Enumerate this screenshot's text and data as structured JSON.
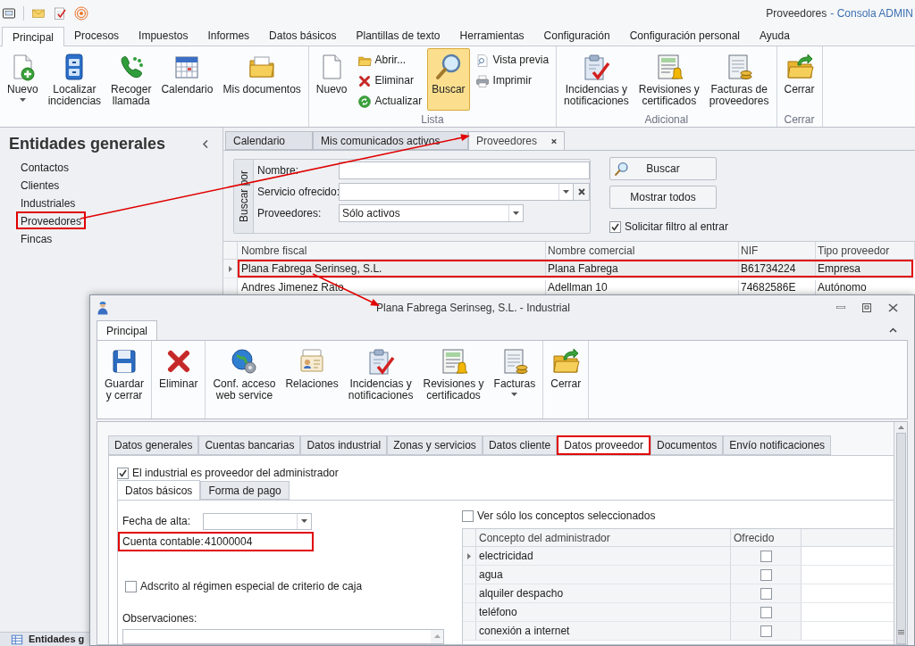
{
  "window": {
    "title": "Proveedores",
    "app_name": "- Consola ADMIN"
  },
  "menu_tabs": [
    {
      "label": "Principal",
      "selected": true
    },
    {
      "label": "Procesos",
      "selected": false
    },
    {
      "label": "Impuestos",
      "selected": false
    },
    {
      "label": "Informes",
      "selected": false
    },
    {
      "label": "Datos básicos",
      "selected": false
    },
    {
      "label": "Plantillas de texto",
      "selected": false
    },
    {
      "label": "Herramientas",
      "selected": false
    },
    {
      "label": "Configuración",
      "selected": false
    },
    {
      "label": "Configuración personal",
      "selected": false
    },
    {
      "label": "Ayuda",
      "selected": false
    }
  ],
  "ribbon": {
    "groups": [
      {
        "items": [
          {
            "label": "Nuevo",
            "kind": "large",
            "dropdown": true,
            "pressed": false
          },
          {
            "label": "Localizar\nincidencias",
            "kind": "large",
            "dropdown": false,
            "pressed": false
          },
          {
            "label": "Recoger\nllamada",
            "kind": "large",
            "dropdown": false,
            "pressed": false
          },
          {
            "label": "Calendario",
            "kind": "large",
            "dropdown": false,
            "pressed": false
          },
          {
            "label": "Mis documentos",
            "kind": "large",
            "dropdown": false,
            "pressed": false
          }
        ]
      },
      {
        "label": "Lista",
        "items": [
          {
            "label": "Nuevo",
            "kind": "large",
            "dropdown": false,
            "pressed": false
          },
          {
            "label": "Abrir...",
            "kind": "small",
            "dropdown": false,
            "pressed": false
          },
          {
            "label": "Eliminar",
            "kind": "small",
            "dropdown": false,
            "pressed": false
          },
          {
            "label": "Actualizar",
            "kind": "small",
            "dropdown": false,
            "pressed": false
          },
          {
            "label": "Buscar",
            "kind": "large",
            "dropdown": false,
            "pressed": true
          },
          {
            "label": "Vista previa",
            "kind": "small",
            "dropdown": false,
            "pressed": false
          },
          {
            "label": "Imprimir",
            "kind": "small",
            "dropdown": false,
            "pressed": false
          }
        ]
      },
      {
        "label": "Adicional",
        "items": [
          {
            "label": "Incidencias y\nnotificaciones",
            "kind": "large",
            "dropdown": false,
            "pressed": false
          },
          {
            "label": "Revisiones y\ncertificados",
            "kind": "large",
            "dropdown": false,
            "pressed": false
          },
          {
            "label": "Facturas de\nproveedores",
            "kind": "large",
            "dropdown": false,
            "pressed": false
          }
        ]
      },
      {
        "label": "Cerrar",
        "items": [
          {
            "label": "Cerrar",
            "kind": "large",
            "dropdown": false,
            "pressed": false
          }
        ]
      }
    ]
  },
  "sidebar": {
    "title": "Entidades generales",
    "items": [
      {
        "label": "Contactos",
        "highlighted": false
      },
      {
        "label": "Clientes",
        "highlighted": false
      },
      {
        "label": "Industriales",
        "highlighted": false
      },
      {
        "label": "Proveedores",
        "highlighted": true
      },
      {
        "label": "Fincas",
        "highlighted": false
      }
    ],
    "bottom_nav": "Entidades g"
  },
  "doc_tabs": [
    {
      "label": "Calendario",
      "selected": false,
      "closable": false
    },
    {
      "label": "Mis comunicados activos",
      "selected": false,
      "closable": false
    },
    {
      "label": "Proveedores",
      "selected": true,
      "closable": true
    }
  ],
  "search": {
    "group_label": "Buscar por",
    "fields": [
      {
        "label": "Nombre:",
        "kind": "text"
      },
      {
        "label": "Servicio ofrecido:",
        "kind": "combo_clear"
      },
      {
        "label": "Proveedores:",
        "kind": "combo",
        "value": "Sólo activos"
      }
    ],
    "buttons": [
      "Buscar",
      "Mostrar todos"
    ],
    "filter_checkbox": {
      "label": "Solicitar filtro al entrar",
      "checked": true
    }
  },
  "grid": {
    "columns": [
      "Nombre fiscal",
      "Nombre comercial",
      "NIF",
      "Tipo proveedor"
    ],
    "rows": [
      {
        "cells": [
          "Plana Fabrega Serinseg, S.L.",
          "Plana Fabrega",
          "B61734224",
          "Empresa"
        ],
        "selected": true,
        "highlighted": true
      },
      {
        "cells": [
          "Andres Jimenez Rato",
          "Adellman 10",
          "74682586E",
          "Autónomo"
        ],
        "selected": false,
        "highlighted": false
      }
    ]
  },
  "dialog": {
    "title": "Plana Fabrega Serinseg, S.L. - Industrial",
    "ribbon_tabs": [
      {
        "label": "Principal",
        "selected": true
      }
    ],
    "ribbon_groups": [
      {
        "items": [
          {
            "label": "Guardar\ny cerrar",
            "kind": "large",
            "dropdown": false,
            "pressed": false
          }
        ]
      },
      {
        "items": [
          {
            "label": "Eliminar",
            "kind": "large",
            "dropdown": false,
            "pressed": false
          }
        ]
      },
      {
        "items": [
          {
            "label": "Conf. acceso\nweb service",
            "kind": "large",
            "dropdown": false,
            "pressed": false
          },
          {
            "label": "Relaciones",
            "kind": "large",
            "dropdown": false,
            "pressed": false
          },
          {
            "label": "Incidencias y\nnotificaciones",
            "kind": "large",
            "dropdown": false,
            "pressed": false
          },
          {
            "label": "Revisiones y\ncertificados",
            "kind": "large",
            "dropdown": false,
            "pressed": false
          },
          {
            "label": "Facturas",
            "kind": "large",
            "dropdown": true,
            "pressed": false
          }
        ]
      },
      {
        "items": [
          {
            "label": "Cerrar",
            "kind": "large",
            "dropdown": false,
            "pressed": false
          }
        ]
      }
    ],
    "tabs": [
      {
        "label": "Datos generales",
        "selected": false,
        "highlighted": false
      },
      {
        "label": "Cuentas bancarias",
        "selected": false,
        "highlighted": false
      },
      {
        "label": "Datos industrial",
        "selected": false,
        "highlighted": false
      },
      {
        "label": "Zonas y servicios",
        "selected": false,
        "highlighted": false
      },
      {
        "label": "Datos cliente",
        "selected": false,
        "highlighted": false
      },
      {
        "label": "Datos proveedor",
        "selected": true,
        "highlighted": true
      },
      {
        "label": "Documentos",
        "selected": false,
        "highlighted": false
      },
      {
        "label": "Envío notificaciones",
        "selected": false,
        "highlighted": false
      }
    ],
    "provider_checkbox": {
      "label": "El industrial es proveedor del administrador",
      "checked": true
    },
    "sub_tabs": [
      {
        "label": "Datos básicos",
        "selected": true
      },
      {
        "label": "Forma de pago",
        "selected": false
      }
    ],
    "fields": [
      {
        "label": "Fecha de alta:",
        "kind": "combo",
        "highlighted": false
      },
      {
        "label": "Cuenta contable:",
        "kind": "text",
        "value": "41000004",
        "highlighted": true
      }
    ],
    "cash_checkbox": {
      "label": "Adscrito al régimen especial de criterio de caja",
      "checked": false
    },
    "notes_label": "Observaciones:",
    "concepts": {
      "filter_checkbox": {
        "label": "Ver sólo los conceptos seleccionados",
        "checked": false
      },
      "columns": [
        "Concepto del administrador",
        "Ofrecido"
      ],
      "rows": [
        {
          "concept": "electricidad",
          "offered": false,
          "selected": true
        },
        {
          "concept": "agua",
          "offered": false,
          "selected": false
        },
        {
          "concept": "alquiler despacho",
          "offered": false,
          "selected": false
        },
        {
          "concept": "teléfono",
          "offered": false,
          "selected": false
        },
        {
          "concept": "conexión a internet",
          "offered": false,
          "selected": false
        }
      ]
    }
  }
}
